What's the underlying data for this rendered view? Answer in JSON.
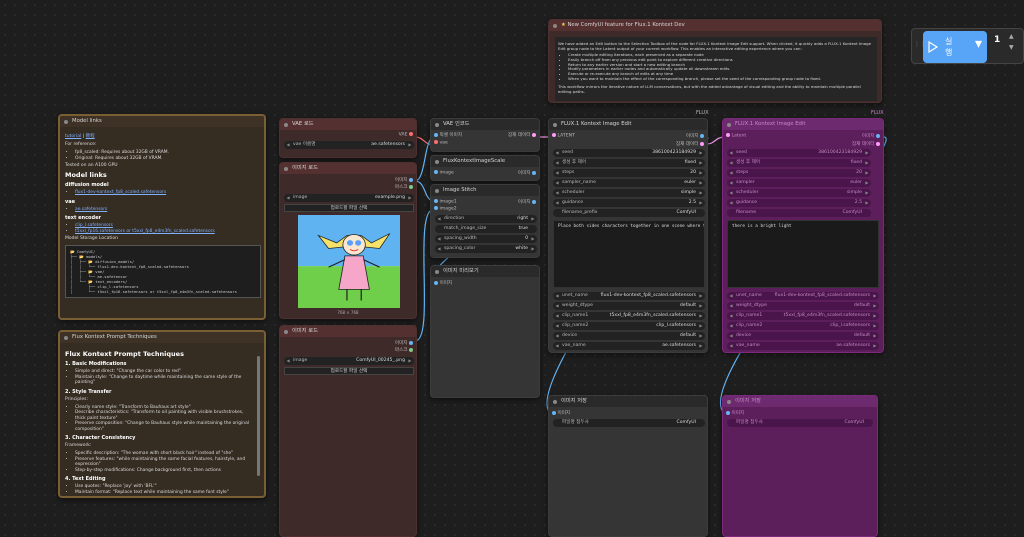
{
  "run": {
    "label": "실\n행",
    "count": "1",
    "up": "▲",
    "down": "▼",
    "dropdown": "▾",
    "handle": "⋮⋮"
  },
  "group_label": "FLUX",
  "group_label2": "FLUX",
  "nodes": {
    "model_links": {
      "title": "Model links",
      "tutorial": "tutorial",
      "sep": " | ",
      "zh": "教程",
      "for_reference": "For reference:",
      "ref_items": [
        "fp8_scaled: Requires about 32GB of VRAM.",
        "Original: Requires about 32GB of VRAM."
      ],
      "tested": "Tested on an A100 GPU",
      "heading": "Model links",
      "diffusion_label": "diffusion model",
      "diffusion_links": [
        "flux1-dev-kontext_fp8_scaled.safetensors"
      ],
      "vae_label": "vae",
      "vae_links": [
        "ae.safetensors"
      ],
      "te_label": "text encoder",
      "te_links": [
        "clip_l.safetensors",
        "t5xxl_fp16.safetensors or t5xxl_fp8_e4m3fn_scaled.safetensors"
      ],
      "storage": "Model Storage Location",
      "tree": "📂 ComfyUI/\n├── 📂 models/\n│   ├── 📂 diffusion_models/\n│   │   └── flux1-dev-kontext_fp8_scaled.safetensors\n│   ├── 📂 vae/\n│   │   └── ae.safetensor\n│   └── 📂 text_encoders/\n│       ├── clip_l.safetensors\n│       └── t5xxl_fp16.safetensors or t5xxl_fp8_e4m3fn_scaled.safetensors"
    },
    "prompt_tech": {
      "title": "Flux Kontext Prompt Techniques",
      "heading": "Flux Kontext Prompt Techniques",
      "s1": "1. Basic Modifications",
      "s1_items": [
        "Simple and direct: \"Change the car color to red\"",
        "Maintain style: \"Change to daytime while maintaining the same style of the painting\""
      ],
      "s2": "2. Style Transfer",
      "s2_label": "Principles:",
      "s2_items": [
        "Clearly name style: \"Transform to Bauhaus art style\"",
        "Describe characteristics: \"Transform to oil painting with visible brushstrokes, thick paint texture\"",
        "Preserve composition: \"Change to Bauhaus style while maintaining the original composition\""
      ],
      "s3": "3. Character Consistency",
      "s3_label": "Framework:",
      "s3_items": [
        "Specific description: \"The woman with short black hair\" instead of \"she\"",
        "Preserve features: \"while maintaining the same facial features, hairstyle, and expression\"",
        "Step-by-step modifications: Change background first, then actions"
      ],
      "s4": "4. Text Editing",
      "s4_items": [
        "Use quotes: \"Replace 'joy' with 'BFL'\"",
        "Maintain format: \"Replace text while maintaining the same font style\""
      ]
    },
    "new_feature": {
      "title": "New ComfyUI feature for Flux.1 Kontext Dev",
      "p1": "We have added an Edit button to the Selection Toolbox of the node for FLUX.1 Kontext Image Edit support. When clicked, it quickly adds a FLUX.1 Kontext Image Edit group node to the Latent output of your current workflow. This enables an interactive editing experience where you can:",
      "items": [
        "Create multiple editing iterations, each preserved as a separate node",
        "Easily branch off from any previous edit point to explore different creative directions",
        "Return to any earlier version and start a new editing branch",
        "Modify parameters in earlier nodes and automatically update all downstream edits",
        "Execute or re-execute any branch of edits at any time",
        "When you want to maintain the effect of the corresponding branch, please set the seed of the corresponding group node to fixed."
      ],
      "p2": "This workflow mirrors the iterative nature of LLM conversations, but with the added advantage of visual editing and the ability to maintain multiple parallel editing paths."
    },
    "vae_load": {
      "title": "VAE 로드",
      "out": "VAE",
      "w_label": "vae 이름명",
      "w_value": "ae.safetensors"
    },
    "img_load1": {
      "title": "이미지 로드",
      "out1": "이미지",
      "out2": "마스크",
      "w_label": "image",
      "w_value": "example.png",
      "btn": "업로드할 파일 선택",
      "caption": "768 × 768"
    },
    "img_load2": {
      "title": "이미지 로드",
      "out1": "이미지",
      "out2": "마스크",
      "w_label": "image",
      "w_value": "ComfyUI_00245_.png",
      "btn": "업로드할 파일 선택"
    },
    "vae_encode": {
      "title": "VAE 인코드",
      "in1": "픽셀 이미지",
      "in2": "vae",
      "out": "잠재 데이터"
    },
    "scale": {
      "title": "FluxKontextImageScale",
      "in1": "image",
      "out": "이미지"
    },
    "stitch": {
      "title": "Image Stitch",
      "in1": "image1",
      "in2": "image2",
      "out": "이미지",
      "widgets": [
        {
          "label": "direction",
          "value": "right"
        },
        {
          "label": "match_image_size",
          "value": "true"
        },
        {
          "label": "spacing_width",
          "value": "0"
        },
        {
          "label": "spacing_color",
          "value": "white"
        }
      ]
    },
    "preview": {
      "title": "이미지 미리보기",
      "in1": "이미지"
    },
    "kontext": {
      "title": "FLUX.1 Kontext Image Edit",
      "in1": "LATENT",
      "out1": "이미지",
      "out2": "잠재 데이터",
      "widgets": [
        {
          "label": "seed",
          "value": "386100423184929"
        },
        {
          "label": "생성 후 제어",
          "value": "fixed"
        },
        {
          "label": "steps",
          "value": "20"
        },
        {
          "label": "sampler_name",
          "value": "euler"
        },
        {
          "label": "scheduler",
          "value": "simple"
        },
        {
          "label": "guidance",
          "value": "2.5"
        },
        {
          "label": "filename_prefix",
          "value": "ComfyUI"
        }
      ],
      "prompt": "Place both sides characters together in one scene where they are hugging",
      "widgets2": [
        {
          "label": "unet_name",
          "value": "flux1-dev-kontext_fp8_scaled.safetensors"
        },
        {
          "label": "weight_dtype",
          "value": "default"
        },
        {
          "label": "clip_name1",
          "value": "t5xxl_fp8_e4m3fn_scaled.safetensors"
        },
        {
          "label": "clip_name2",
          "value": "clip_l.safetensors"
        },
        {
          "label": "device",
          "value": "default"
        },
        {
          "label": "vae_name",
          "value": "ae.safetensors"
        }
      ]
    },
    "kontext2": {
      "title": "FLUX.1 Kontext Image Edit",
      "in1": "Latent",
      "out1": "이미지",
      "out2": "잠재 데이터",
      "widgets": [
        {
          "label": "seed",
          "value": "386100423184929"
        },
        {
          "label": "생성 후 제어",
          "value": "fixed"
        },
        {
          "label": "steps",
          "value": "20"
        },
        {
          "label": "sampler",
          "value": "euler"
        },
        {
          "label": "scheduler",
          "value": "simple"
        },
        {
          "label": "guidance",
          "value": "2.5"
        },
        {
          "label": "filename",
          "value": "ComfyUI"
        }
      ],
      "prompt": "there is a bright light",
      "widgets2": [
        {
          "label": "unet_name",
          "value": "flux1-dev-kontext_fp8_scaled.safetensors"
        },
        {
          "label": "weight_dtype",
          "value": "default"
        },
        {
          "label": "clip_name1",
          "value": "t5xxl_fp8_e4m3fn_scaled.safetensors"
        },
        {
          "label": "clip_name2",
          "value": "clip_l.safetensors"
        },
        {
          "label": "device",
          "value": "default"
        },
        {
          "label": "vae_name",
          "value": "ae.safetensors"
        }
      ]
    },
    "save1": {
      "title": "이미지 저장",
      "in1": "이미지",
      "w_label": "파일명 접두사",
      "w_value": "ComfyUI"
    },
    "save2": {
      "title": "이미지 저장",
      "in1": "이미지",
      "w_label": "파일명 접두사",
      "w_value": "ComfyUI"
    }
  },
  "colors": {
    "vae": "#ff6e6e",
    "image": "#64b5f6",
    "latent": "#ff9cf9",
    "accent": "#58a4f7"
  }
}
